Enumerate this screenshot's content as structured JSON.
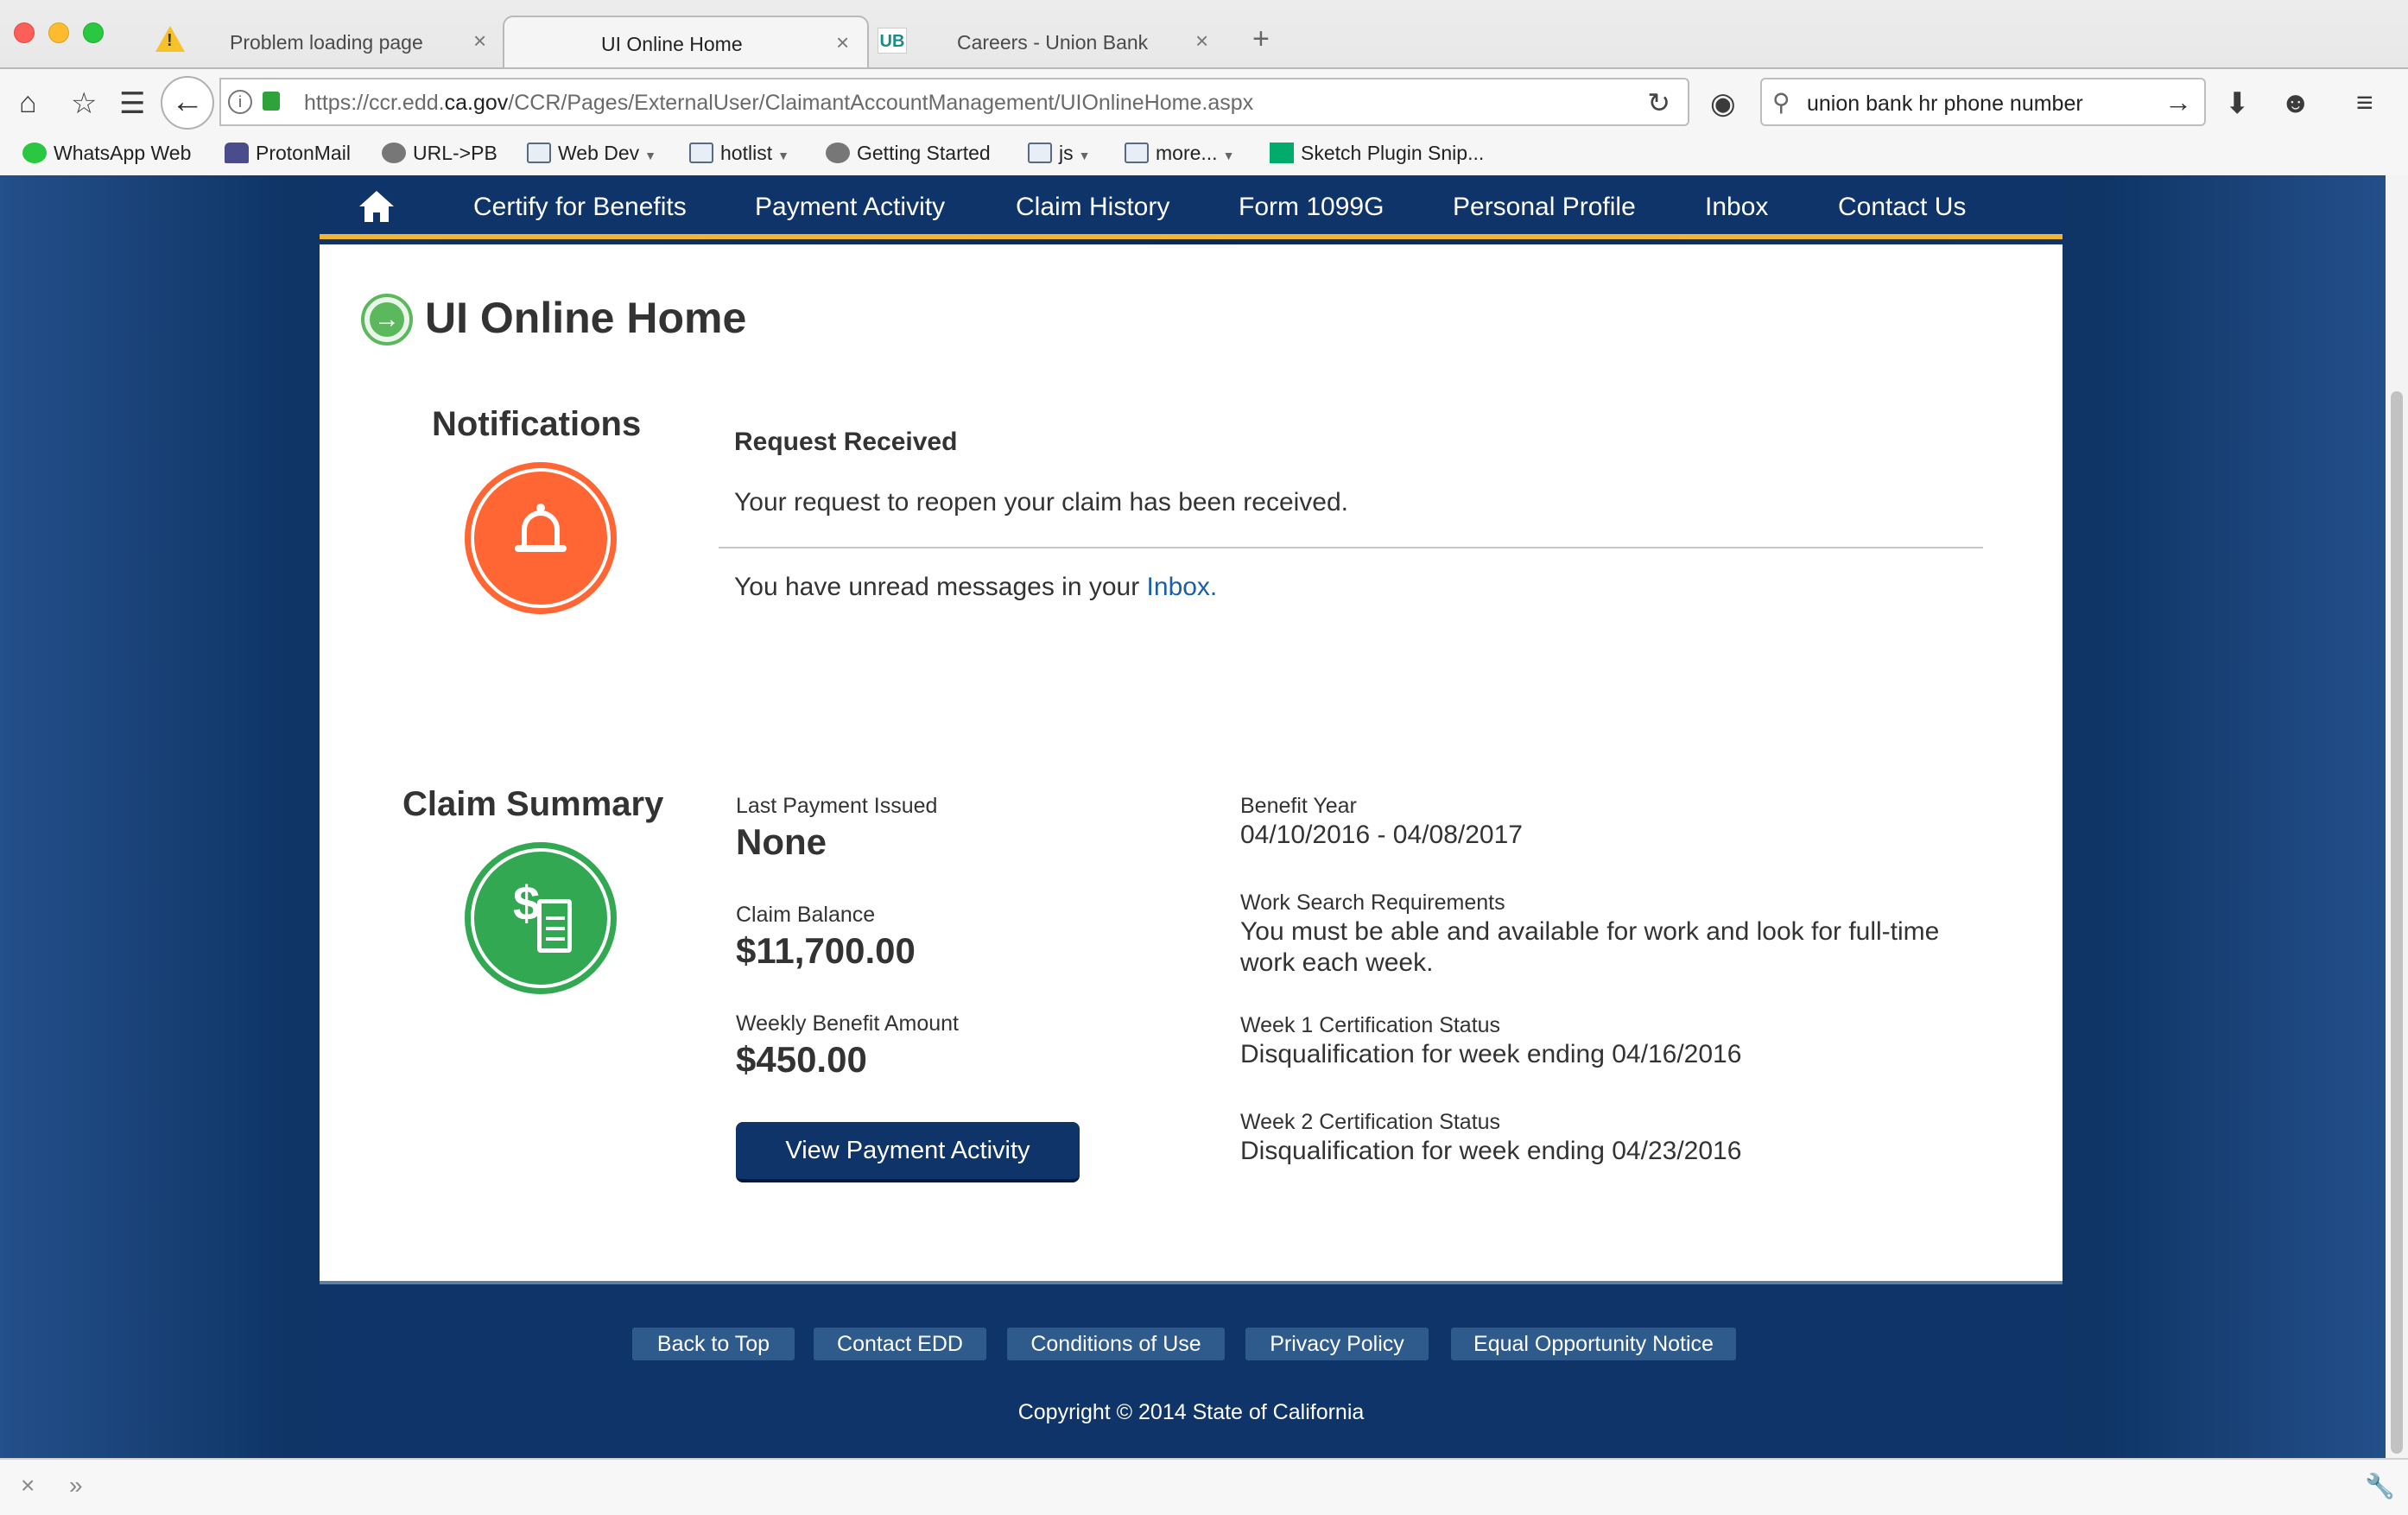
{
  "browser": {
    "tabs": [
      {
        "title": "Problem loading page",
        "icon": "warning-icon"
      },
      {
        "title": "UI Online Home",
        "icon": ""
      },
      {
        "title": "Careers - Union Bank",
        "icon": "ub-favicon",
        "favicon_text": "UB"
      }
    ],
    "url_prefix": "https://ccr.edd.",
    "url_domain": "ca.gov",
    "url_path": "/CCR/Pages/ExternalUser/ClaimantAccountManagement/UIOnlineHome.aspx",
    "search_value": "union bank hr phone number",
    "bookmarks": [
      {
        "label": "WhatsApp Web",
        "icon": "whatsapp-icon"
      },
      {
        "label": "ProtonMail",
        "icon": "protonmail-icon"
      },
      {
        "label": "URL->PB",
        "icon": "globe-icon"
      },
      {
        "label": "Web Dev",
        "icon": "folder-icon"
      },
      {
        "label": "hotlist",
        "icon": "folder-icon"
      },
      {
        "label": "Getting Started",
        "icon": "globe-icon"
      },
      {
        "label": "js",
        "icon": "folder-icon"
      },
      {
        "label": "more...",
        "icon": "folder-icon"
      },
      {
        "label": "Sketch Plugin Snip...",
        "icon": "medium-icon"
      }
    ]
  },
  "site_nav": {
    "items": [
      "Certify for Benefits",
      "Payment Activity",
      "Claim History",
      "Form 1099G",
      "Personal Profile",
      "Inbox",
      "Contact Us"
    ]
  },
  "page": {
    "title": "UI Online Home"
  },
  "notifications": {
    "heading": "Notifications",
    "title": "Request Received",
    "message": "Your request to reopen your claim has been received.",
    "unread_prefix": "You have unread messages in your ",
    "unread_link": "Inbox."
  },
  "claim_summary": {
    "heading": "Claim Summary",
    "last_payment_label": "Last Payment Issued",
    "last_payment_value": "None",
    "claim_balance_label": "Claim Balance",
    "claim_balance_value": "$11,700.00",
    "weekly_benefit_label": "Weekly Benefit Amount",
    "weekly_benefit_value": "$450.00",
    "benefit_year_label": "Benefit Year",
    "benefit_year_value": "04/10/2016 - 04/08/2017",
    "work_search_label": "Work Search Requirements",
    "work_search_value": "You must be able and available for work and look for full-time work each week.",
    "week1_label": "Week 1 Certification Status",
    "week1_value": "Disqualification for week ending 04/16/2016",
    "week2_label": "Week 2 Certification Status",
    "week2_value": "Disqualification for week ending 04/23/2016",
    "button_label": "View Payment Activity"
  },
  "footer": {
    "links": [
      "Back to Top",
      "Contact EDD",
      "Conditions of Use",
      "Privacy Policy",
      "Equal Opportunity Notice"
    ],
    "copyright": "Copyright © 2014 State of California"
  }
}
